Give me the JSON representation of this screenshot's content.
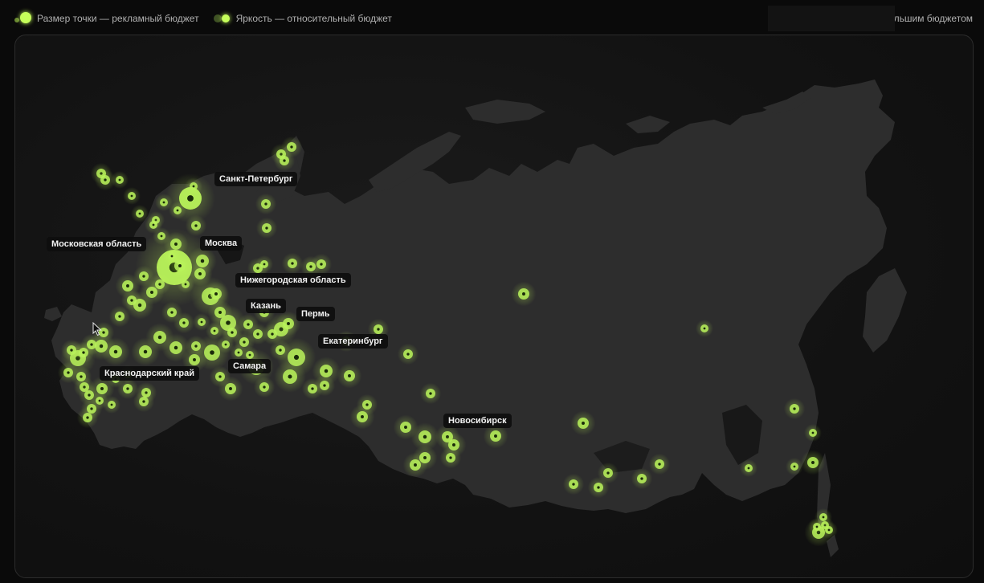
{
  "legend": {
    "size_label": "Размер точки — рекламный бюджет",
    "brightness_label": "Яркость — относительный бюджет",
    "accent_color": "#c6ff5a"
  },
  "top_right": {
    "prefix": "П",
    "suffix": "ольшим бюджетом"
  },
  "map": {
    "land_color": "#2d2d2d",
    "marker_color": "#b8f25a"
  },
  "labels": [
    {
      "id": "spb",
      "text": "Санкт-Петербург"
    },
    {
      "id": "mo",
      "text": "Московская область"
    },
    {
      "id": "msk",
      "text": "Москва"
    },
    {
      "id": "nn",
      "text": "Нижегородская область"
    },
    {
      "id": "kzn",
      "text": "Казань"
    },
    {
      "id": "perm",
      "text": "Пермь"
    },
    {
      "id": "ekb",
      "text": "Екатеринбург"
    },
    {
      "id": "krd",
      "text": "Краснодарский край"
    },
    {
      "id": "sam",
      "text": "Самара"
    },
    {
      "id": "nsk",
      "text": "Новосибирск"
    }
  ]
}
